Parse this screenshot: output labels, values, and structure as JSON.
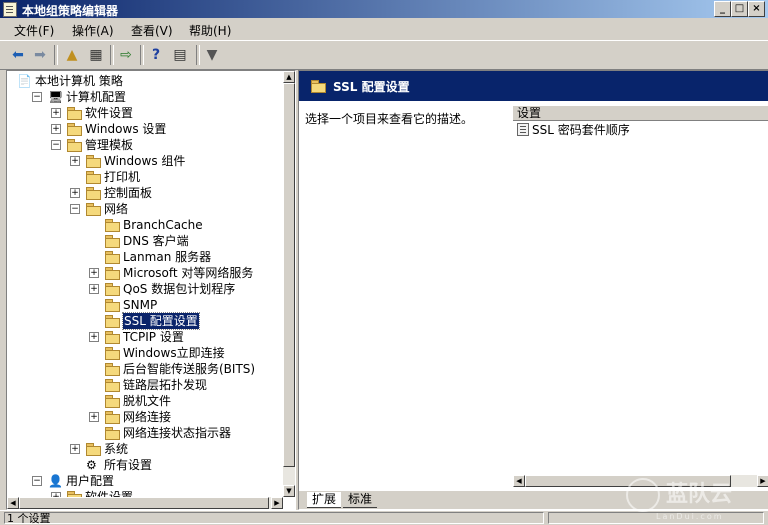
{
  "window": {
    "title": "本地组策略编辑器"
  },
  "menu": [
    "文件(F)",
    "操作(A)",
    "查看(V)",
    "帮助(H)"
  ],
  "tree": {
    "rows": [
      {
        "label": "本地计算机 策略",
        "depth": 0,
        "expander": "",
        "icon": "policy",
        "selected": false
      },
      {
        "label": "计算机配置",
        "depth": 1,
        "expander": "-",
        "icon": "computer",
        "selected": false
      },
      {
        "label": "软件设置",
        "depth": 2,
        "expander": "+",
        "icon": "folder",
        "selected": false
      },
      {
        "label": "Windows 设置",
        "depth": 2,
        "expander": "+",
        "icon": "folder",
        "selected": false
      },
      {
        "label": "管理模板",
        "depth": 2,
        "expander": "-",
        "icon": "folder",
        "selected": false
      },
      {
        "label": "Windows 组件",
        "depth": 3,
        "expander": "+",
        "icon": "folder",
        "selected": false
      },
      {
        "label": "打印机",
        "depth": 3,
        "expander": "",
        "icon": "folder",
        "selected": false
      },
      {
        "label": "控制面板",
        "depth": 3,
        "expander": "+",
        "icon": "folder",
        "selected": false
      },
      {
        "label": "网络",
        "depth": 3,
        "expander": "-",
        "icon": "folder",
        "selected": false
      },
      {
        "label": "BranchCache",
        "depth": 4,
        "expander": "",
        "icon": "folder",
        "selected": false
      },
      {
        "label": "DNS 客户端",
        "depth": 4,
        "expander": "",
        "icon": "folder",
        "selected": false
      },
      {
        "label": "Lanman 服务器",
        "depth": 4,
        "expander": "",
        "icon": "folder",
        "selected": false
      },
      {
        "label": "Microsoft 对等网络服务",
        "depth": 4,
        "expander": "+",
        "icon": "folder",
        "selected": false
      },
      {
        "label": "QoS 数据包计划程序",
        "depth": 4,
        "expander": "+",
        "icon": "folder",
        "selected": false
      },
      {
        "label": "SNMP",
        "depth": 4,
        "expander": "",
        "icon": "folder",
        "selected": false
      },
      {
        "label": "SSL 配置设置",
        "depth": 4,
        "expander": "",
        "icon": "folder",
        "selected": true
      },
      {
        "label": "TCPIP 设置",
        "depth": 4,
        "expander": "+",
        "icon": "folder",
        "selected": false
      },
      {
        "label": "Windows立即连接",
        "depth": 4,
        "expander": "",
        "icon": "folder",
        "selected": false
      },
      {
        "label": "后台智能传送服务(BITS)",
        "depth": 4,
        "expander": "",
        "icon": "folder",
        "selected": false
      },
      {
        "label": "链路层拓扑发现",
        "depth": 4,
        "expander": "",
        "icon": "folder",
        "selected": false
      },
      {
        "label": "脱机文件",
        "depth": 4,
        "expander": "",
        "icon": "folder",
        "selected": false
      },
      {
        "label": "网络连接",
        "depth": 4,
        "expander": "+",
        "icon": "folder",
        "selected": false
      },
      {
        "label": "网络连接状态指示器",
        "depth": 4,
        "expander": "",
        "icon": "folder",
        "selected": false
      },
      {
        "label": "系统",
        "depth": 3,
        "expander": "+",
        "icon": "folder",
        "selected": false
      },
      {
        "label": "所有设置",
        "depth": 3,
        "expander": "",
        "icon": "settings",
        "selected": false
      },
      {
        "label": "用户配置",
        "depth": 1,
        "expander": "-",
        "icon": "user",
        "selected": false
      },
      {
        "label": "软件设置",
        "depth": 2,
        "expander": "+",
        "icon": "folder",
        "selected": false
      }
    ]
  },
  "details": {
    "title": "SSL 配置设置",
    "description": "选择一个项目来查看它的描述。",
    "column_header": "设置",
    "items": [
      "SSL 密码套件顺序"
    ],
    "tabs": [
      "扩展",
      "标准"
    ]
  },
  "status": {
    "text": "1 个设置"
  },
  "watermark": {
    "text": "蓝队云",
    "sub": "LanDui.com"
  }
}
